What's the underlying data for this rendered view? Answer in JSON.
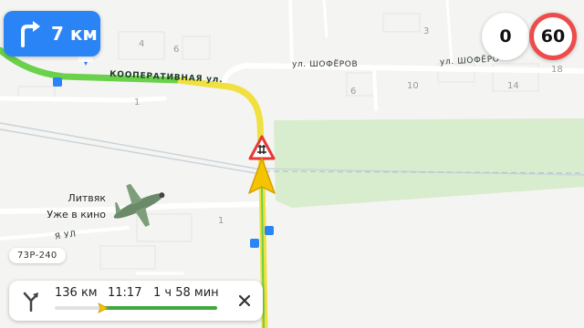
{
  "navigation": {
    "next_turn": {
      "direction_icon": "turn-right-icon",
      "distance": "7 км"
    },
    "current_speed": "0",
    "speed_limit": "60",
    "road_badge": "73Р-240",
    "route": {
      "distance": "136 км",
      "arrival_time": "11:17",
      "duration": "1 ч 58 мин",
      "progress_traveled_fraction": 0.3
    }
  },
  "map": {
    "street_labels": {
      "kooperativnaya": "КООПЕРАТИВНАЯ ул.",
      "shoferov_1": "ул. ШОФЁРОВ",
      "shoferov_2": "ул. ШОФЁРО",
      "bottom_left": "Я УЛ"
    },
    "house_numbers": {
      "h4": "4",
      "h6": "6",
      "h1a": "1",
      "h3": "3",
      "h6b": "6",
      "h10": "10",
      "h14": "14",
      "h18": "18",
      "h1b": "1"
    },
    "poi": {
      "title": "Литвяк",
      "subtitle": "Уже в кино"
    },
    "colors": {
      "route_main": "#f0e040",
      "route_green": "#6ad14a",
      "park": "#d8ecce",
      "speed_limit_ring": "#ee4b4b",
      "turn_panel": "#2a84f5"
    }
  }
}
